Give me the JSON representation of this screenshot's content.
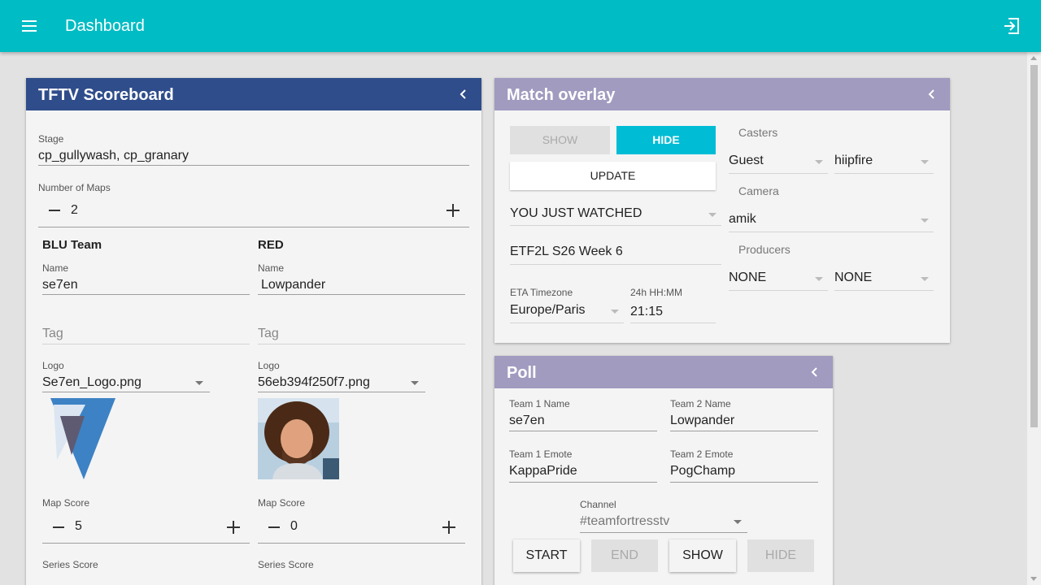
{
  "app": {
    "title": "Dashboard"
  },
  "colors": {
    "appbar": "#00bcc4",
    "scoreboard_header": "#2f4d8b",
    "overlay_header": "#a09bbf",
    "accent": "#00bcd4"
  },
  "icons": {
    "menu": "menu-icon",
    "logout": "logout-icon",
    "collapse": "chevron-left-icon"
  },
  "scoreboard": {
    "title": "TFTV Scoreboard",
    "stage_label": "Stage",
    "stage_value": "cp_gullywash, cp_granary",
    "maps_label": "Number of Maps",
    "maps_value": "2",
    "blu": {
      "heading": "BLU Team",
      "name_label": "Name",
      "name_value": "se7en",
      "tag_placeholder": "Tag",
      "logo_label": "Logo",
      "logo_value": "Se7en_Logo.png",
      "map_score_label": "Map Score",
      "map_score_value": "5",
      "series_score_label": "Series Score"
    },
    "red": {
      "heading": "RED",
      "name_label": "Name",
      "name_value": "Lowpander",
      "tag_placeholder": "Tag",
      "logo_label": "Logo",
      "logo_value": "56eb394f250f7.png",
      "map_score_label": "Map Score",
      "map_score_value": "0",
      "series_score_label": "Series Score"
    }
  },
  "overlay": {
    "title": "Match overlay",
    "show_button": "SHOW",
    "hide_button": "HIDE",
    "update_button": "UPDATE",
    "mode_value": "YOU JUST WATCHED",
    "event_value": "ETF2L S26 Week 6",
    "tz_label": "ETA Timezone",
    "tz_value": "Europe/Paris",
    "time_label": "24h HH:MM",
    "time_value": "21:15",
    "casters_label": "Casters",
    "caster1": "Guest",
    "caster2": "hiipfire",
    "camera_label": "Camera",
    "camera_value": "amik",
    "producers_label": "Producers",
    "producer1": "NONE",
    "producer2": "NONE"
  },
  "poll": {
    "title": "Poll",
    "team1_name_label": "Team 1 Name",
    "team1_name_value": "se7en",
    "team2_name_label": "Team 2 Name",
    "team2_name_value": "Lowpander",
    "team1_emote_label": "Team 1 Emote",
    "team1_emote_value": "KappaPride",
    "team2_emote_label": "Team 2 Emote",
    "team2_emote_value": "PogChamp",
    "channel_label": "Channel",
    "channel_value": "#teamfortresstv",
    "start_button": "START",
    "end_button": "END",
    "show_button": "SHOW",
    "hide_button": "HIDE"
  }
}
